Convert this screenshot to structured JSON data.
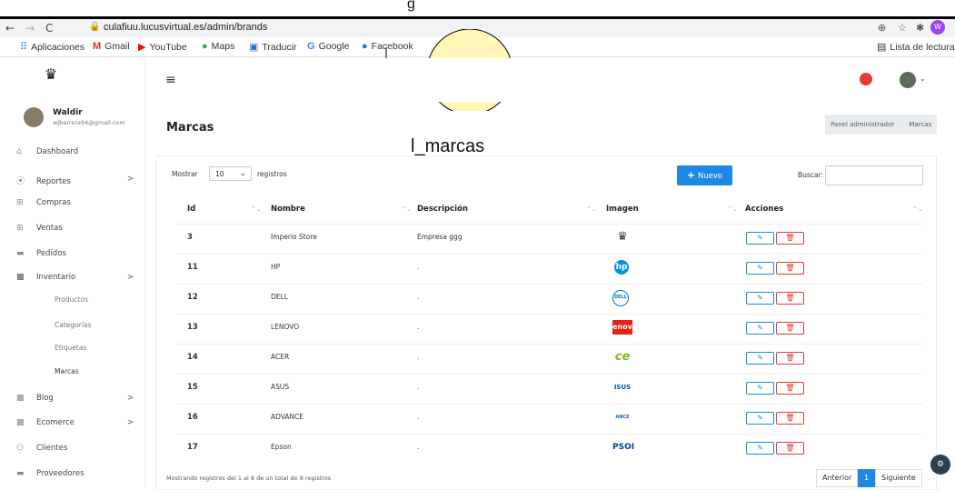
{
  "top_annotation": "g",
  "browser": {
    "url": "culafiuu.lucusvirtual.es/admin/brands",
    "avatar_letter": "W",
    "reading_list": "Lista de lectura"
  },
  "bookmarks": [
    "Aplicaciones",
    "Gmail",
    "YouTube",
    "Maps",
    "Traducir",
    "Google",
    "Facebook"
  ],
  "user": {
    "name": "Waldir",
    "email": "wjbarrera94@gmail.com"
  },
  "sidebar": {
    "items": [
      {
        "label": "Dashboard",
        "icon": "home-icon"
      },
      {
        "label": "Reportes",
        "icon": "chart-icon",
        "arrow": ">"
      },
      {
        "label": "Compras",
        "icon": "cart-icon"
      },
      {
        "label": "Ventas",
        "icon": "cart-icon"
      },
      {
        "label": "Pedidos",
        "icon": "truck-icon"
      },
      {
        "label": "Inventario",
        "icon": "boxes-icon",
        "arrow": ">"
      }
    ],
    "subitems": [
      "Productos",
      "Categorías",
      "Etiquetas",
      "Marcas"
    ],
    "items2": [
      {
        "label": "Blog",
        "icon": "boxes-icon",
        "arrow": ">"
      },
      {
        "label": "Ecomerce",
        "icon": "boxes-icon",
        "arrow": ">"
      },
      {
        "label": "Clientes",
        "icon": "users-icon"
      },
      {
        "label": "Proveedores",
        "icon": "truck-icon"
      }
    ]
  },
  "page": {
    "title": "Marcas",
    "breadcrumb": [
      "Panel administrador",
      "Marcas"
    ],
    "annotation": "l_marcas"
  },
  "table": {
    "show_label": "Mostrar",
    "show_value": "10",
    "records_label": "registros",
    "new_button": "Nuevo",
    "search_label": "Buscar:",
    "headers": [
      "Id",
      "Nombre",
      "Descripción",
      "Imagen",
      "Acciones"
    ],
    "rows": [
      {
        "id": "3",
        "name": "Imperio Store",
        "desc": "Empresa ggg",
        "logo": "crown"
      },
      {
        "id": "11",
        "name": "HP",
        "desc": ".",
        "logo": "hp"
      },
      {
        "id": "12",
        "name": "DELL",
        "desc": ".",
        "logo": "DELL"
      },
      {
        "id": "13",
        "name": "LENOVO",
        "desc": ".",
        "logo": "enov"
      },
      {
        "id": "14",
        "name": "ACER",
        "desc": ".",
        "logo": "ce"
      },
      {
        "id": "15",
        "name": "ASUS",
        "desc": ".",
        "logo": "ISUS"
      },
      {
        "id": "16",
        "name": "ADVANCE",
        "desc": ".",
        "logo": "ANCE"
      },
      {
        "id": "17",
        "name": "Epson",
        "desc": ".",
        "logo": "PSOI"
      }
    ],
    "footer": "Mostrando registros del 1 al 8 de un total de 8 registros",
    "pagination": {
      "prev": "Anterior",
      "page": "1",
      "next": "Siguiente"
    }
  },
  "colors": {
    "accent": "#1e88e5",
    "danger": "#e53935",
    "sidebar_text": "#444444"
  }
}
